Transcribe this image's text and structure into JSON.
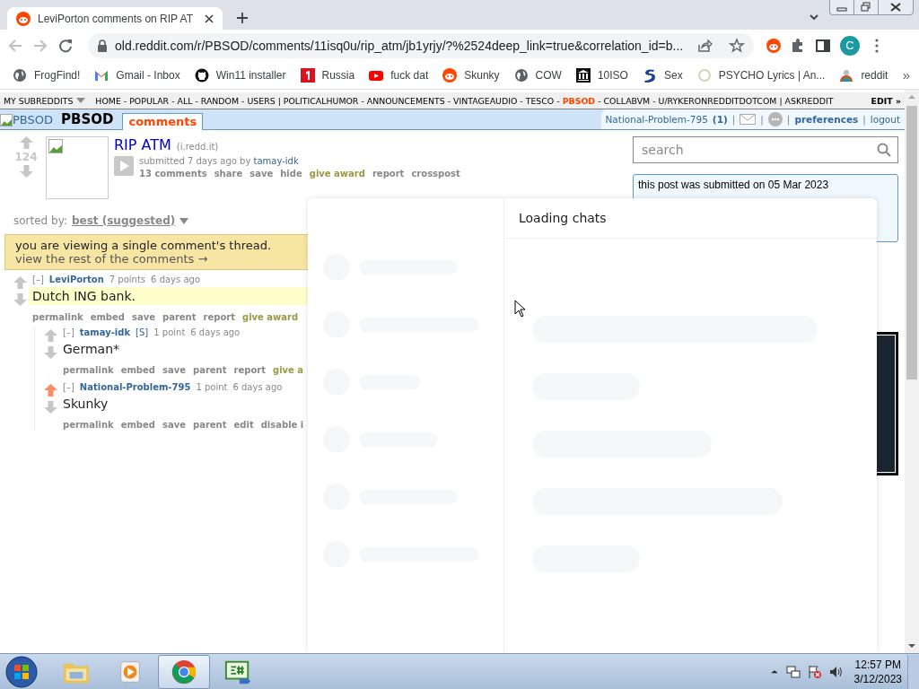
{
  "browser": {
    "tab": {
      "title": "LeviPorton comments on RIP AT",
      "selected": true
    },
    "url": "old.reddit.com/r/PBSOD/comments/11isq0u/rip_atm/jb1yrjy/?%2524deep_link=true&correlation_id=b...",
    "avatar": "C",
    "bookmarks": [
      {
        "label": "FrogFind!",
        "kind": "globe"
      },
      {
        "label": "Gmail - Inbox",
        "kind": "gmail"
      },
      {
        "label": "Win11 installer",
        "kind": "github"
      },
      {
        "label": "Russia",
        "kind": "tile"
      },
      {
        "label": "fuck dat",
        "kind": "youtube"
      },
      {
        "label": "Skunky",
        "kind": "reddit"
      },
      {
        "label": "COW",
        "kind": "globe"
      },
      {
        "label": "10ISO",
        "kind": "museum"
      },
      {
        "label": "Sex",
        "kind": "swoosh"
      },
      {
        "label": "PSYCHO Lyrics | An...",
        "kind": "ring"
      },
      {
        "label": "reddit",
        "kind": "rainbow"
      }
    ],
    "more": "»"
  },
  "subreddit_bar": {
    "menu": "MY SUBREDDITS",
    "separator": "-",
    "group_separator": "|",
    "groups": [
      {
        "items": [
          {
            "label": "HOME",
            "selected": false
          },
          {
            "label": "POPULAR",
            "selected": false
          },
          {
            "label": "ALL",
            "selected": false
          },
          {
            "label": "RANDOM",
            "selected": false
          },
          {
            "label": "USERS",
            "selected": false
          }
        ]
      },
      {
        "items": [
          {
            "label": "POLITICALHUMOR",
            "selected": false
          },
          {
            "label": "ANNOUNCEMENTS",
            "selected": false
          },
          {
            "label": "VINTAGEAUDIO",
            "selected": false
          },
          {
            "label": "TESCO",
            "selected": false
          },
          {
            "label": "PBSOD",
            "selected": true
          },
          {
            "label": "COLLABVM",
            "selected": false
          },
          {
            "label": "U/RYKERONREDDITDOTCOM",
            "selected": false
          }
        ]
      },
      {
        "items": [
          {
            "label": "ASKREDDIT",
            "selected": false
          }
        ]
      }
    ],
    "edit": "EDIT »"
  },
  "header": {
    "logo_alt": "PBSOD",
    "subreddit": "PBSOD",
    "tabs": [
      {
        "label": "comments",
        "selected": true
      }
    ],
    "user": {
      "name": "National-Problem-795",
      "karma": "(1)",
      "separator": "|",
      "links": [
        "preferences",
        "logout"
      ]
    }
  },
  "post": {
    "score": "124",
    "title": "RIP ATM",
    "domain": "(i.redd.it)",
    "tagline": "submitted 7 days ago by",
    "author": "tamay-idk",
    "actions": [
      {
        "label": "13 comments",
        "kind": "normal"
      },
      {
        "label": "share",
        "kind": "normal"
      },
      {
        "label": "save",
        "kind": "normal"
      },
      {
        "label": "hide",
        "kind": "normal"
      },
      {
        "label": "give award",
        "kind": "award"
      },
      {
        "label": "report",
        "kind": "normal"
      },
      {
        "label": "crosspost",
        "kind": "normal"
      }
    ]
  },
  "sort": {
    "label": "sorted by:",
    "value": "best (suggested)"
  },
  "notice": {
    "text": "you are viewing a single comment's thread.",
    "link": "view the rest of the comments →"
  },
  "comments": [
    {
      "collapse": "[–]",
      "author": "LeviPorton",
      "score": "7 points",
      "time": "6 days ago",
      "body": "Dutch ING bank.",
      "highlighted": true,
      "upvoted": false,
      "actions": [
        {
          "label": "permalink",
          "kind": "normal"
        },
        {
          "label": "embed",
          "kind": "normal"
        },
        {
          "label": "save",
          "kind": "normal"
        },
        {
          "label": "parent",
          "kind": "normal"
        },
        {
          "label": "report",
          "kind": "normal"
        },
        {
          "label": "give award",
          "kind": "award"
        }
      ],
      "children": [
        {
          "collapse": "[–]",
          "author": "tamay-idk",
          "flair": "[S]",
          "score": "1 point",
          "time": "6 days ago",
          "body": "German*",
          "highlighted": false,
          "upvoted": false,
          "actions": [
            {
              "label": "permalink",
              "kind": "normal"
            },
            {
              "label": "embed",
              "kind": "normal"
            },
            {
              "label": "save",
              "kind": "normal"
            },
            {
              "label": "parent",
              "kind": "normal"
            },
            {
              "label": "report",
              "kind": "normal"
            },
            {
              "label": "give a",
              "kind": "award"
            }
          ]
        },
        {
          "collapse": "[–]",
          "author": "National-Problem-795",
          "score": "1 point",
          "time": "6 days ago",
          "body": "Skunky",
          "highlighted": false,
          "upvoted": true,
          "actions": [
            {
              "label": "permalink",
              "kind": "normal"
            },
            {
              "label": "embed",
              "kind": "normal"
            },
            {
              "label": "save",
              "kind": "normal"
            },
            {
              "label": "parent",
              "kind": "normal"
            },
            {
              "label": "edit",
              "kind": "normal"
            },
            {
              "label": "disable i",
              "kind": "normal"
            }
          ]
        }
      ]
    }
  ],
  "sidebar": {
    "search": {
      "placeholder": "search"
    },
    "info": "this post was submitted on 05 Mar 2023"
  },
  "chat": {
    "title": "Loading chats"
  },
  "taskbar": {
    "apps": [
      {
        "kind": "folder",
        "selected": false
      },
      {
        "kind": "media",
        "selected": false
      },
      {
        "kind": "chrome",
        "selected": true
      },
      {
        "kind": "csharp",
        "selected": false
      }
    ],
    "time": "12:57 PM",
    "date": "3/12/2023"
  }
}
